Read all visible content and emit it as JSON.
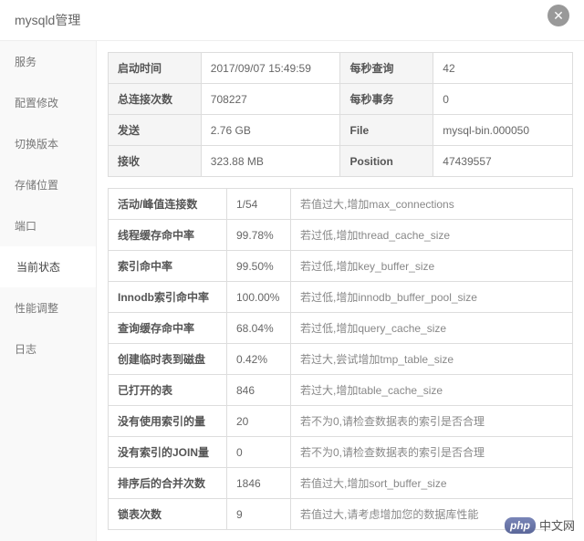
{
  "header": {
    "title": "mysqld管理"
  },
  "sidebar": {
    "items": [
      {
        "label": "服务"
      },
      {
        "label": "配置修改"
      },
      {
        "label": "切换版本"
      },
      {
        "label": "存储位置"
      },
      {
        "label": "端口"
      },
      {
        "label": "当前状态"
      },
      {
        "label": "性能调整"
      },
      {
        "label": "日志"
      }
    ],
    "activeIndex": 5
  },
  "statusTable": {
    "rows": [
      {
        "l1": "启动时间",
        "v1": "2017/09/07 15:49:59",
        "l2": "每秒查询",
        "v2": "42"
      },
      {
        "l1": "总连接次数",
        "v1": "708227",
        "l2": "每秒事务",
        "v2": "0"
      },
      {
        "l1": "发送",
        "v1": "2.76 GB",
        "l2": "File",
        "v2": "mysql-bin.000050"
      },
      {
        "l1": "接收",
        "v1": "323.88 MB",
        "l2": "Position",
        "v2": "47439557"
      }
    ]
  },
  "metricsTable": {
    "rows": [
      {
        "metric": "活动/峰值连接数",
        "value": "1/54",
        "hint": "若值过大,增加max_connections"
      },
      {
        "metric": "线程缓存命中率",
        "value": "99.78%",
        "hint": "若过低,增加thread_cache_size"
      },
      {
        "metric": "索引命中率",
        "value": "99.50%",
        "hint": "若过低,增加key_buffer_size"
      },
      {
        "metric": "Innodb索引命中率",
        "value": "100.00%",
        "hint": "若过低,增加innodb_buffer_pool_size"
      },
      {
        "metric": "查询缓存命中率",
        "value": "68.04%",
        "hint": "若过低,增加query_cache_size"
      },
      {
        "metric": "创建临时表到磁盘",
        "value": "0.42%",
        "hint": "若过大,尝试增加tmp_table_size"
      },
      {
        "metric": "已打开的表",
        "value": "846",
        "hint": "若过大,增加table_cache_size"
      },
      {
        "metric": "没有使用索引的量",
        "value": "20",
        "hint": "若不为0,请检查数据表的索引是否合理"
      },
      {
        "metric": "没有索引的JOIN量",
        "value": "0",
        "hint": "若不为0,请检查数据表的索引是否合理"
      },
      {
        "metric": "排序后的合并次数",
        "value": "1846",
        "hint": "若值过大,增加sort_buffer_size"
      },
      {
        "metric": "锁表次数",
        "value": "9",
        "hint": "若值过大,请考虑增加您的数据库性能"
      }
    ]
  },
  "watermark": {
    "badge": "php",
    "text": "中文网"
  }
}
